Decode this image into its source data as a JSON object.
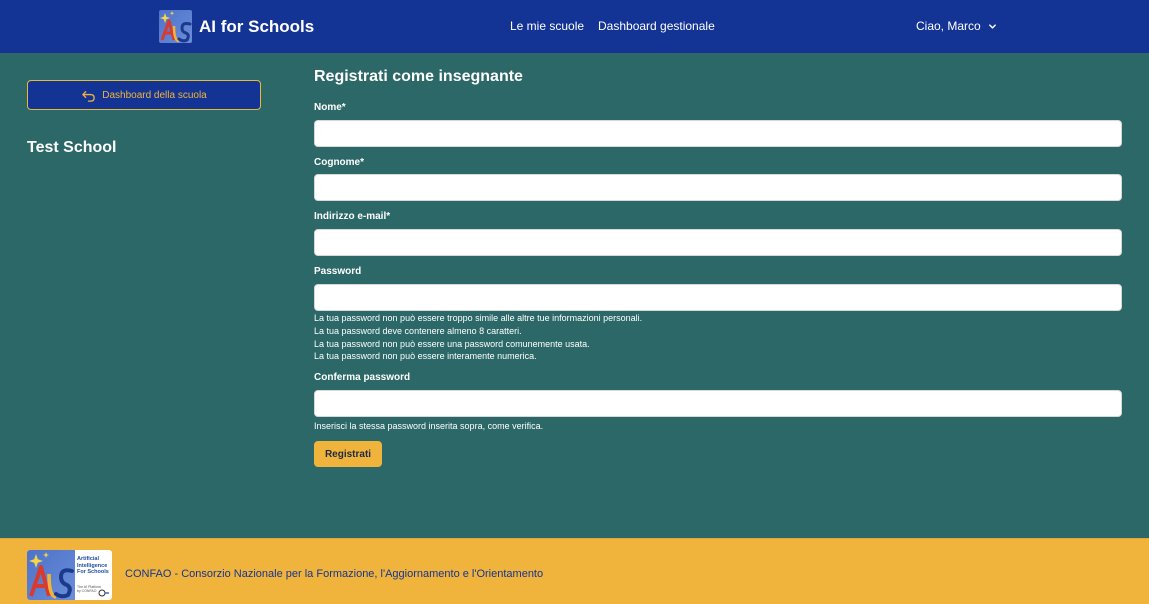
{
  "header": {
    "brand_name": "AI for Schools",
    "nav": [
      "Le mie scuole",
      "Dashboard gestionale"
    ],
    "user_greeting": "Ciao, Marco"
  },
  "sidebar": {
    "back_button_label": "Dashboard della scuola",
    "school_name": "Test School"
  },
  "form": {
    "title": "Registrati come insegnante",
    "fields": [
      {
        "label": "Nome*",
        "value": "",
        "placeholder": ""
      },
      {
        "label": "Cognome*",
        "value": "",
        "placeholder": ""
      },
      {
        "label": "Indirizzo e-mail*",
        "value": "",
        "placeholder": ""
      },
      {
        "label": "Password",
        "value": "",
        "placeholder": ""
      },
      {
        "label": "Conferma password",
        "value": "",
        "placeholder": ""
      }
    ],
    "password_help": [
      "La tua password non può essere troppo simile alle altre tue informazioni personali.",
      "La tua password deve contenere almeno 8 caratteri.",
      "La tua password non può essere una password comunemente usata.",
      "La tua password non può essere interamente numerica."
    ],
    "confirm_help": "Inserisci la stessa password inserita sopra, come verifica.",
    "submit_label": "Registrati"
  },
  "footer": {
    "logo_tagline": [
      "Artificial",
      "Intelligence",
      "For Schools"
    ],
    "logo_small": [
      "The AI Platform",
      "by CONFAO"
    ],
    "text": "CONFAO - Consorzio Nazionale per la Formazione, l'Aggiornamento e l'Orientamento"
  },
  "colors": {
    "header_bg": "#143495",
    "body_bg": "#2b6867",
    "accent": "#f0b43c"
  },
  "icons": {
    "back": "arrow-uturn-left-icon",
    "user_menu": "chevron-down-icon",
    "logo_sparkle": "sparkle-icon"
  }
}
